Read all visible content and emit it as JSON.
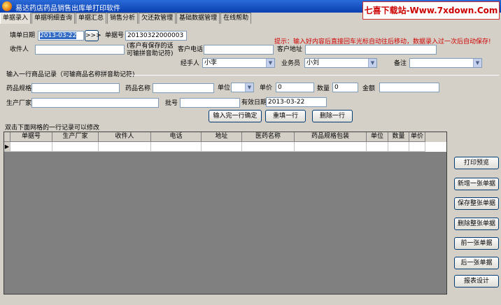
{
  "window": {
    "title": "易达药店药品销售出库单打印软件",
    "watermark": "七喜下载站-Www.7xdown.Com"
  },
  "tabs": [
    "单据录入",
    "单据明细查询",
    "单据汇总",
    "销售分析",
    "欠还款管理",
    "基础数据管理",
    "在线帮助"
  ],
  "header_form": {
    "date_label": "填单日期",
    "date_value": "2013-03-22",
    "date_button": ">>>",
    "doc_no_label": "单据号",
    "doc_no_value": "20130322000003",
    "hint": "提示：输入好内容后直接回车光标自动往后移动，数据录入过一次后自动保存!",
    "receiver_label": "收件人",
    "receiver_value": "",
    "receiver_note_1": "(客户有保存的话",
    "receiver_note_2": "可输拼音助记符)",
    "phone_label": "客户电话",
    "phone_value": "",
    "address_label": "客户地址",
    "address_value": "",
    "handler_label": "经手人",
    "handler_value": "小李",
    "salesman_label": "业务员",
    "salesman_value": "小刘",
    "remark_label": "备注",
    "remark_value": ""
  },
  "item_form": {
    "section_title": "输入一行商品记录（可输商品名称拼音助记符)",
    "spec_label": "药品规格",
    "spec_value": "",
    "name_label": "药品名称",
    "name_value": "",
    "unit_label": "单位",
    "unit_value": "",
    "price_label": "单价",
    "price_value": "0",
    "qty_label": "数量",
    "qty_value": "0",
    "amount_label": "金额",
    "amount_value": "",
    "maker_label": "生产厂家",
    "maker_value": "",
    "batch_label": "批号",
    "batch_value": "",
    "expiry_label": "有效日期",
    "expiry_value": "2013-03-22",
    "confirm_button": "输入完一行确定",
    "refill_button": "重填一行",
    "delete_button": "删除一行"
  },
  "grid": {
    "caption": "双击下面网格的一行记录可以修改",
    "columns": [
      "单据号",
      "生产厂家",
      "收件人",
      "电话",
      "地址",
      "医药名称",
      "药品规格包装",
      "单位",
      "数量",
      "单价"
    ],
    "row_indicator": "▶"
  },
  "side_buttons": [
    "打印预览",
    "新增一张单据",
    "保存整张单据",
    "删除整张单据",
    "前一张单据",
    "后一张单据",
    "报表设计"
  ]
}
